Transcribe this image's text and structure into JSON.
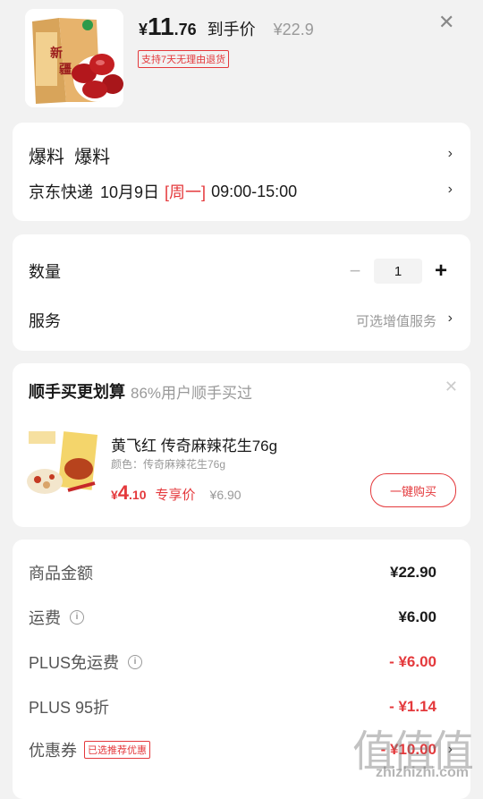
{
  "product": {
    "price_symbol": "¥",
    "price_int": "11",
    "price_dec": ".76",
    "net_price_label": "到手价",
    "original_price": "¥22.9",
    "return_tag": "支持7天无理由退货",
    "close_icon": "close-icon"
  },
  "shipping": {
    "title": "爆料  爆料",
    "carrier": "京东快递",
    "date": "10月9日",
    "weekday": "[周一]",
    "time": "09:00-15:00"
  },
  "quantity": {
    "label": "数量",
    "minus": "−",
    "value": "1",
    "plus": "+"
  },
  "service": {
    "label": "服务",
    "value": "可选增值服务"
  },
  "addon": {
    "title": "顺手买更划算",
    "subtitle": "86%用户顺手买过",
    "item_name": "黄飞红 传奇麻辣花生76g",
    "item_spec": "颜色：传奇麻辣花生76g",
    "price_symbol": "¥",
    "price_int": "4",
    "price_dec": ".10",
    "price_label": "专享价",
    "price_orig": "¥6.90",
    "buy_label": "一键购买"
  },
  "summary": {
    "goods_label": "商品金额",
    "goods_value": "¥22.90",
    "freight_label": "运费",
    "freight_value": "¥6.00",
    "plus_free_label": "PLUS免运费",
    "plus_free_value": "- ¥6.00",
    "plus_discount_label": "PLUS 95折",
    "plus_discount_value": "- ¥1.14",
    "coupon_label": "优惠券",
    "coupon_tag": "已选推荐优惠",
    "coupon_value": "- ¥10.00"
  },
  "watermark": {
    "text": "值",
    "url": "zhizhizhi.com"
  },
  "colors": {
    "accent": "#e4393c",
    "bg": "#f2f2f2"
  }
}
